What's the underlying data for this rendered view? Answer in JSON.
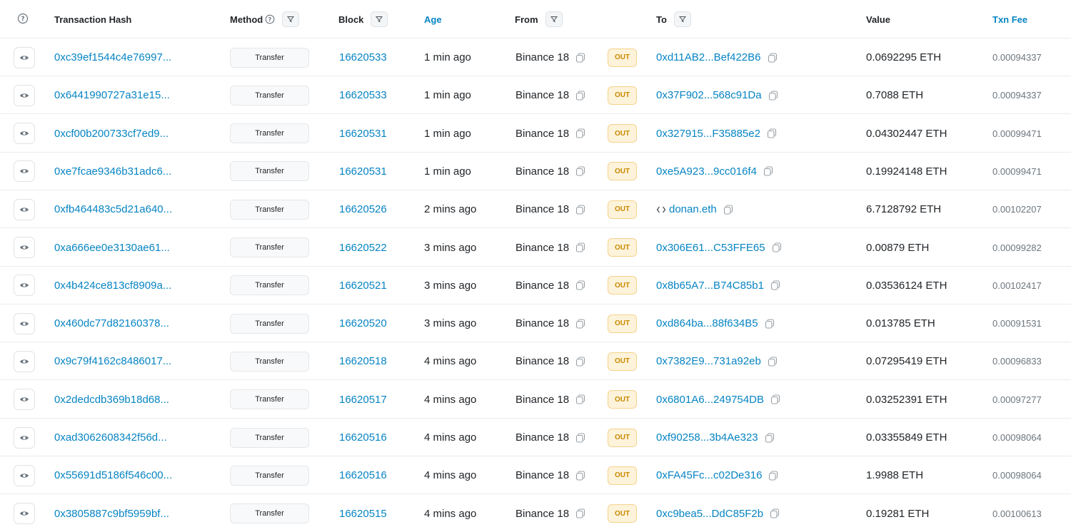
{
  "header": {
    "hash": "Transaction Hash",
    "method": "Method",
    "block": "Block",
    "age": "Age",
    "from": "From",
    "to": "To",
    "value": "Value",
    "fee": "Txn Fee"
  },
  "rows": [
    {
      "hash": "0xc39ef1544c4e76997...",
      "method": "Transfer",
      "block": "16620533",
      "age": "1 min ago",
      "from": "Binance 18",
      "dir": "OUT",
      "to": "0xd11AB2...Bef422B6",
      "value": "0.0692295 ETH",
      "fee": "0.00094337"
    },
    {
      "hash": "0x6441990727a31e15...",
      "method": "Transfer",
      "block": "16620533",
      "age": "1 min ago",
      "from": "Binance 18",
      "dir": "OUT",
      "to": "0x37F902...568c91Da",
      "value": "0.7088 ETH",
      "fee": "0.00094337"
    },
    {
      "hash": "0xcf00b200733cf7ed9...",
      "method": "Transfer",
      "block": "16620531",
      "age": "1 min ago",
      "from": "Binance 18",
      "dir": "OUT",
      "to": "0x327915...F35885e2",
      "value": "0.04302447 ETH",
      "fee": "0.00099471"
    },
    {
      "hash": "0xe7fcae9346b31adc6...",
      "method": "Transfer",
      "block": "16620531",
      "age": "1 min ago",
      "from": "Binance 18",
      "dir": "OUT",
      "to": "0xe5A923...9cc016f4",
      "value": "0.19924148 ETH",
      "fee": "0.00099471"
    },
    {
      "hash": "0xfb464483c5d21a640...",
      "method": "Transfer",
      "block": "16620526",
      "age": "2 mins ago",
      "from": "Binance 18",
      "dir": "OUT",
      "to": "donan.eth",
      "value": "6.7128792 ETH",
      "fee": "0.00102207"
    },
    {
      "hash": "0xa666ee0e3130ae61...",
      "method": "Transfer",
      "block": "16620522",
      "age": "3 mins ago",
      "from": "Binance 18",
      "dir": "OUT",
      "to": "0x306E61...C53FFE65",
      "value": "0.00879 ETH",
      "fee": "0.00099282"
    },
    {
      "hash": "0x4b424ce813cf8909a...",
      "method": "Transfer",
      "block": "16620521",
      "age": "3 mins ago",
      "from": "Binance 18",
      "dir": "OUT",
      "to": "0x8b65A7...B74C85b1",
      "value": "0.03536124 ETH",
      "fee": "0.00102417"
    },
    {
      "hash": "0x460dc77d82160378...",
      "method": "Transfer",
      "block": "16620520",
      "age": "3 mins ago",
      "from": "Binance 18",
      "dir": "OUT",
      "to": "0xd864ba...88f634B5",
      "value": "0.013785 ETH",
      "fee": "0.00091531"
    },
    {
      "hash": "0x9c79f4162c8486017...",
      "method": "Transfer",
      "block": "16620518",
      "age": "4 mins ago",
      "from": "Binance 18",
      "dir": "OUT",
      "to": "0x7382E9...731a92eb",
      "value": "0.07295419 ETH",
      "fee": "0.00096833"
    },
    {
      "hash": "0x2dedcdb369b18d68...",
      "method": "Transfer",
      "block": "16620517",
      "age": "4 mins ago",
      "from": "Binance 18",
      "dir": "OUT",
      "to": "0x6801A6...249754DB",
      "value": "0.03252391 ETH",
      "fee": "0.00097277"
    },
    {
      "hash": "0xad3062608342f56d...",
      "method": "Transfer",
      "block": "16620516",
      "age": "4 mins ago",
      "from": "Binance 18",
      "dir": "OUT",
      "to": "0xf90258...3b4Ae323",
      "value": "0.03355849 ETH",
      "fee": "0.00098064"
    },
    {
      "hash": "0x55691d5186f546c00...",
      "method": "Transfer",
      "block": "16620516",
      "age": "4 mins ago",
      "from": "Binance 18",
      "dir": "OUT",
      "to": "0xFA45Fc...c02De316",
      "value": "1.9988 ETH",
      "fee": "0.00098064"
    },
    {
      "hash": "0x3805887c9bf5959bf...",
      "method": "Transfer",
      "block": "16620515",
      "age": "4 mins ago",
      "from": "Binance 18",
      "dir": "OUT",
      "to": "0xc9bea5...DdC85F2b",
      "value": "0.19281 ETH",
      "fee": "0.00100613"
    }
  ],
  "icons": {
    "header_info": "question-circle-icon",
    "filter": "filter-icon",
    "row_preview": "eye-icon",
    "copy": "copy-icon",
    "contract": "code-icon"
  },
  "colors": {
    "link": "#0784c3",
    "out_badge_bg": "#fdf3db",
    "out_badge_text": "#c98a00"
  }
}
